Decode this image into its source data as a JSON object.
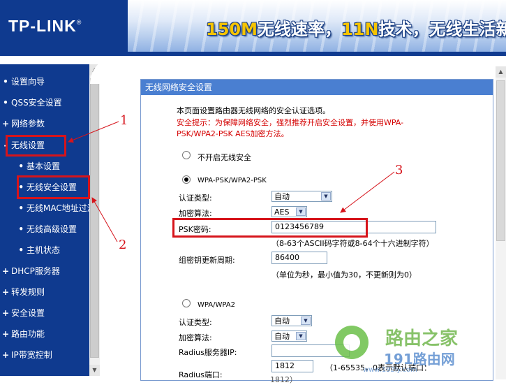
{
  "header": {
    "logo": "TP-LINK",
    "logo_mark": "®",
    "slogan_part1": "150M",
    "slogan_part2": "无线速率，",
    "slogan_part3": "11N",
    "slogan_part4": "技术，无线生活新"
  },
  "sidebar": {
    "items": [
      {
        "label": "设置向导",
        "bullet": "•"
      },
      {
        "label": "QSS安全设置",
        "bullet": "•"
      },
      {
        "label": "网络参数",
        "bullet": "+"
      },
      {
        "label": "无线设置",
        "bullet": "-"
      },
      {
        "label": "基本设置",
        "bullet": "•"
      },
      {
        "label": "无线安全设置",
        "bullet": "•"
      },
      {
        "label": "无线MAC地址过滤",
        "bullet": "•"
      },
      {
        "label": "无线高级设置",
        "bullet": "•"
      },
      {
        "label": "主机状态",
        "bullet": "•"
      },
      {
        "label": "DHCP服务器",
        "bullet": "+"
      },
      {
        "label": "转发规则",
        "bullet": "+"
      },
      {
        "label": "安全设置",
        "bullet": "+"
      },
      {
        "label": "路由功能",
        "bullet": "+"
      },
      {
        "label": "IP带宽控制",
        "bullet": "+"
      }
    ]
  },
  "panel": {
    "title": "无线网络安全设置",
    "intro": "本页面设置路由器无线网络的安全认证选项。",
    "warning_line1": "安全提示：为保障网络安全，强烈推荐开启安全设置，并使用WPA-",
    "warning_line2": "PSK/WPA2-PSK AES加密方法。",
    "option_none": "不开启无线安全",
    "option_wpapsk": "WPA-PSK/WPA2-PSK",
    "auth_type_label": "认证类型:",
    "auth_type_value": "自动",
    "encrypt_label": "加密算法:",
    "encrypt_value": "AES",
    "psk_label": "PSK密码:",
    "psk_value": "0123456789",
    "psk_hint": "（8-63个ASCII码字符或8-64个十六进制字符）",
    "rekey_label": "组密钥更新周期:",
    "rekey_value": "86400",
    "rekey_hint": "（单位为秒，最小值为30，不更新则为0）",
    "option_wpa": "WPA/WPA2",
    "wpa_auth_label": "认证类型:",
    "wpa_auth_value": "自动",
    "wpa_encrypt_label": "加密算法:",
    "wpa_encrypt_value": "自动",
    "radius_ip_label": "Radius服务器IP:",
    "radius_ip_value": "",
    "radius_port_label": "Radius端口:",
    "radius_port_value": "1812",
    "radius_port_hint": "（1-65535，0表示默认端口：",
    "radius_port_hint2": "1812）"
  },
  "annotations": {
    "n1": "1",
    "n2": "2",
    "n3": "3"
  },
  "watermark": {
    "name": "路由之家",
    "url": "191路由网",
    "url_small": "www.192ly.com"
  },
  "colors": {
    "brand_blue": "#0f3a8f",
    "panel_title": "#4a7fd1",
    "warning": "#d40000",
    "annotation_red": "#d6141b"
  }
}
